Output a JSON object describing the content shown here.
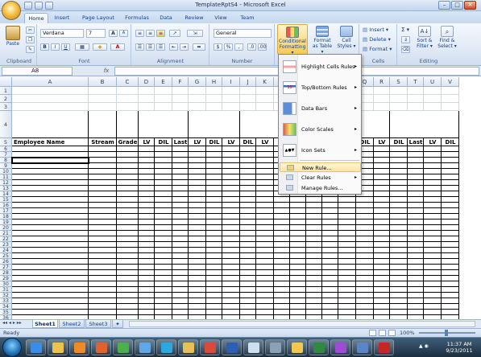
{
  "window": {
    "title": "TemplateRptS4 - Microsoft Excel",
    "controls": {
      "minimize": "–",
      "maximize": "□",
      "close": "✕"
    }
  },
  "tabs": [
    "Home",
    "Insert",
    "Page Layout",
    "Formulas",
    "Data",
    "Review",
    "View",
    "Team"
  ],
  "active_tab": "Home",
  "ribbon": {
    "clipboard": {
      "label": "Clipboard",
      "paste": "Paste"
    },
    "font": {
      "label": "Font",
      "name": "Verdana",
      "size": "7",
      "bold": "B",
      "italic": "I",
      "underline": "U",
      "grow": "A",
      "shrink": "A"
    },
    "alignment": {
      "label": "Alignment"
    },
    "number": {
      "label": "Number",
      "format": "General",
      "currency": "$",
      "percent": "%",
      "comma": ","
    },
    "styles": {
      "conditional_formatting": [
        "Conditional",
        "Formatting ▾"
      ],
      "format_as_table": [
        "Format",
        "as Table ▾"
      ],
      "cell_styles": [
        "Cell",
        "Styles ▾"
      ]
    },
    "cells": {
      "label": "Cells",
      "insert": "Insert ▾",
      "delete": "Delete ▾",
      "format": "Format ▾"
    },
    "editing": {
      "label": "Editing",
      "sum": "Σ ▾",
      "sort_filter": [
        "Sort &",
        "Filter ▾"
      ],
      "find_select": [
        "Find &",
        "Select ▾"
      ]
    }
  },
  "formula_bar": {
    "name_box": "A8",
    "fx": "fx",
    "formula": ""
  },
  "columns": [
    "A",
    "B",
    "C",
    "D",
    "E",
    "F",
    "G",
    "H",
    "I",
    "J",
    "K",
    "L",
    "M",
    "N",
    "O",
    "P",
    "Q",
    "R",
    "S",
    "T",
    "U",
    "V"
  ],
  "rows": [
    "1",
    "2",
    "3",
    "4",
    "5",
    "6",
    "7",
    "8",
    "9",
    "10",
    "11",
    "12",
    "13",
    "14",
    "15",
    "16",
    "17",
    "18",
    "19",
    "20",
    "21",
    "22",
    "23",
    "24",
    "25",
    "26",
    "27",
    "28",
    "29",
    "30",
    "31",
    "32",
    "33",
    "34",
    "35",
    "36"
  ],
  "header_row": {
    "A": "Employee Name",
    "B": "Stream",
    "C": "Grade",
    "D": "LV",
    "E": "DIL",
    "F": "Last",
    "G": "LV",
    "H": "DIL",
    "I": "LV",
    "J": "DIL",
    "K": "LV",
    "Q": "DIL",
    "R": "LV",
    "S": "DIL",
    "T": "Last",
    "U": "LV",
    "V": "DIL"
  },
  "cf_menu": {
    "items": [
      {
        "label": "Highlight Cells Rules",
        "icon": "highlight-cells-icon",
        "submenu": true
      },
      {
        "label": "Top/Bottom Rules",
        "icon": "top-bottom-icon",
        "submenu": true
      },
      {
        "label": "Data Bars",
        "icon": "data-bars-icon",
        "submenu": true
      },
      {
        "label": "Color Scales",
        "icon": "color-scales-icon",
        "submenu": true
      },
      {
        "label": "Icon Sets",
        "icon": "icon-sets-icon",
        "submenu": true
      }
    ],
    "small_items": [
      {
        "label": "New Rule...",
        "highlighted": true,
        "submenu": false
      },
      {
        "label": "Clear Rules",
        "highlighted": false,
        "submenu": true
      },
      {
        "label": "Manage Rules...",
        "highlighted": false,
        "submenu": false
      }
    ],
    "submenu_arrow": "▸"
  },
  "sheets": [
    "Sheet1",
    "Sheet2",
    "Sheet3"
  ],
  "active_sheet": "Sheet1",
  "status": {
    "text": "Ready",
    "zoom": "100%"
  },
  "taskbar": {
    "time": "11:37 AM",
    "date": "9/23/2011"
  },
  "colors": {
    "ribbon_bg": "#dfe9f5",
    "highlight": "#ffe59a",
    "grid_line": "#d0d7e5",
    "selection": "#000000"
  }
}
